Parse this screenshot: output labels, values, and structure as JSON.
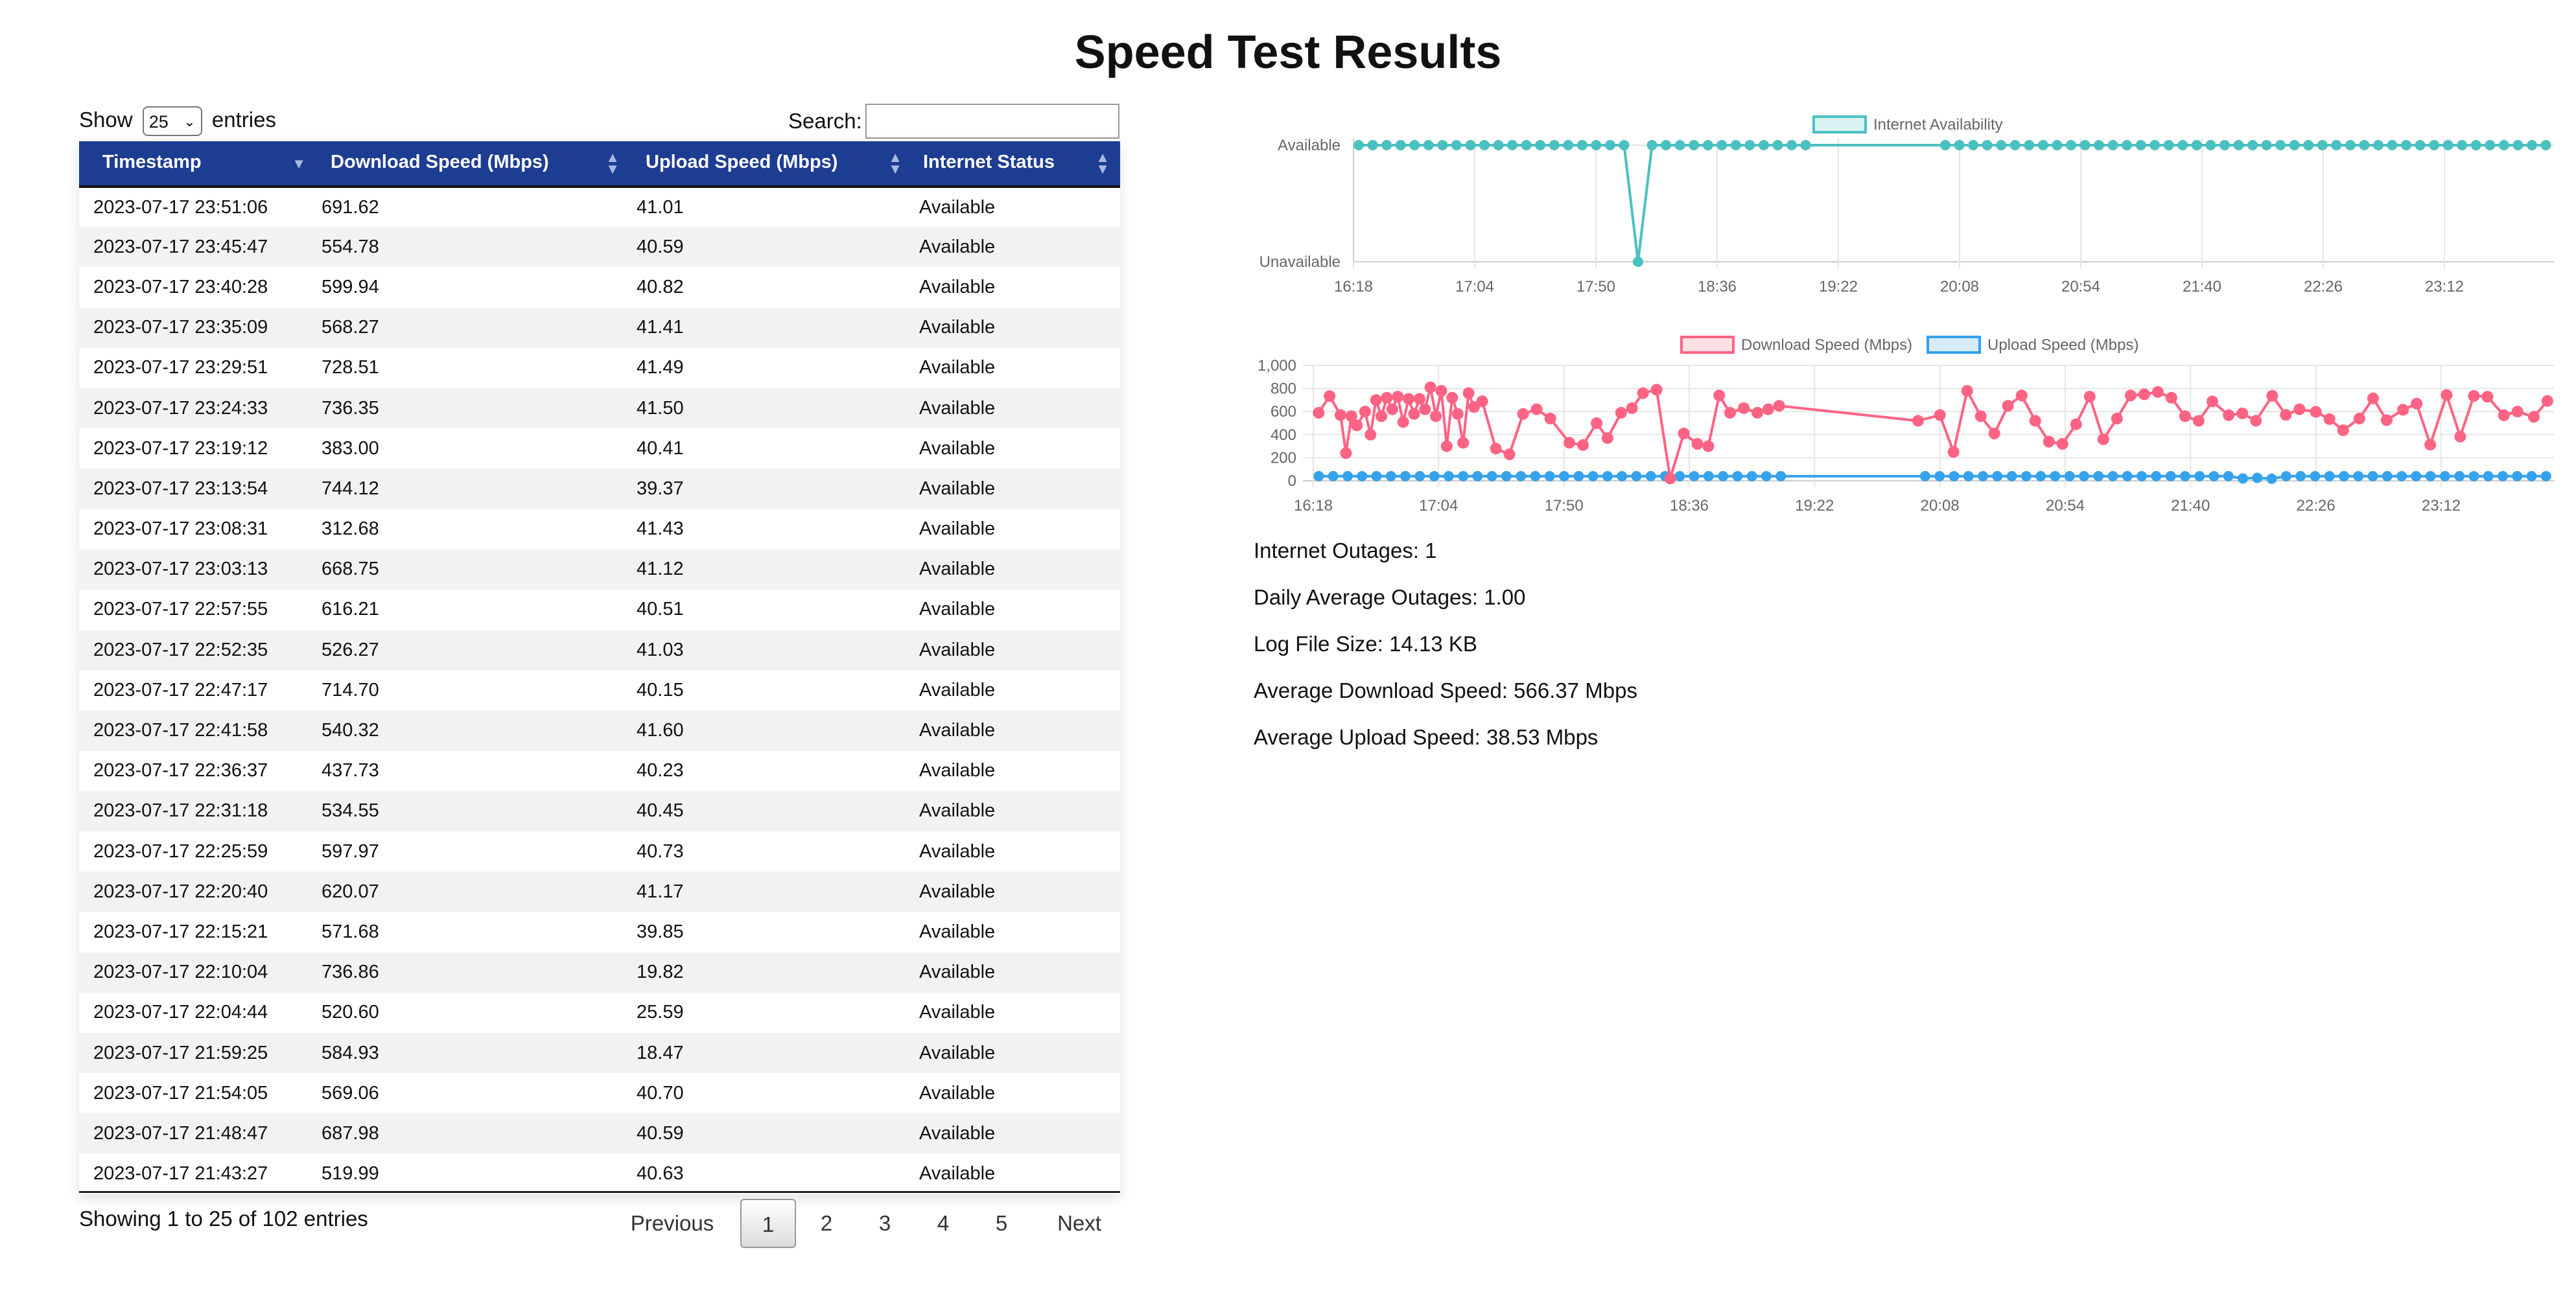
{
  "page": {
    "title": "Speed Test Results"
  },
  "table_controls": {
    "show_label": "Show",
    "entries_value": "25",
    "entries_label": "entries",
    "search_label": "Search:",
    "search_value": ""
  },
  "table": {
    "columns": [
      "Timestamp",
      "Download Speed (Mbps)",
      "Upload Speed (Mbps)",
      "Internet Status"
    ],
    "rows": [
      [
        "2023-07-17 23:51:06",
        "691.62",
        "41.01",
        "Available"
      ],
      [
        "2023-07-17 23:45:47",
        "554.78",
        "40.59",
        "Available"
      ],
      [
        "2023-07-17 23:40:28",
        "599.94",
        "40.82",
        "Available"
      ],
      [
        "2023-07-17 23:35:09",
        "568.27",
        "41.41",
        "Available"
      ],
      [
        "2023-07-17 23:29:51",
        "728.51",
        "41.49",
        "Available"
      ],
      [
        "2023-07-17 23:24:33",
        "736.35",
        "41.50",
        "Available"
      ],
      [
        "2023-07-17 23:19:12",
        "383.00",
        "40.41",
        "Available"
      ],
      [
        "2023-07-17 23:13:54",
        "744.12",
        "39.37",
        "Available"
      ],
      [
        "2023-07-17 23:08:31",
        "312.68",
        "41.43",
        "Available"
      ],
      [
        "2023-07-17 23:03:13",
        "668.75",
        "41.12",
        "Available"
      ],
      [
        "2023-07-17 22:57:55",
        "616.21",
        "40.51",
        "Available"
      ],
      [
        "2023-07-17 22:52:35",
        "526.27",
        "41.03",
        "Available"
      ],
      [
        "2023-07-17 22:47:17",
        "714.70",
        "40.15",
        "Available"
      ],
      [
        "2023-07-17 22:41:58",
        "540.32",
        "41.60",
        "Available"
      ],
      [
        "2023-07-17 22:36:37",
        "437.73",
        "40.23",
        "Available"
      ],
      [
        "2023-07-17 22:31:18",
        "534.55",
        "40.45",
        "Available"
      ],
      [
        "2023-07-17 22:25:59",
        "597.97",
        "40.73",
        "Available"
      ],
      [
        "2023-07-17 22:20:40",
        "620.07",
        "41.17",
        "Available"
      ],
      [
        "2023-07-17 22:15:21",
        "571.68",
        "39.85",
        "Available"
      ],
      [
        "2023-07-17 22:10:04",
        "736.86",
        "19.82",
        "Available"
      ],
      [
        "2023-07-17 22:04:44",
        "520.60",
        "25.59",
        "Available"
      ],
      [
        "2023-07-17 21:59:25",
        "584.93",
        "18.47",
        "Available"
      ],
      [
        "2023-07-17 21:54:05",
        "569.06",
        "40.70",
        "Available"
      ],
      [
        "2023-07-17 21:48:47",
        "687.98",
        "40.59",
        "Available"
      ],
      [
        "2023-07-17 21:43:27",
        "519.99",
        "40.63",
        "Available"
      ]
    ]
  },
  "table_footer": {
    "info": "Showing 1 to 25 of 102 entries",
    "previous": "Previous",
    "pages": [
      "1",
      "2",
      "3",
      "4",
      "5"
    ],
    "active_page": "1",
    "next": "Next"
  },
  "stats": {
    "outages": "Internet Outages: 1",
    "daily_avg": "Daily Average Outages: 1.00",
    "log_size": "Log File Size: 14.13 KB",
    "avg_download": "Average Download Speed: 566.37 Mbps",
    "avg_upload": "Average Upload Speed: 38.53 Mbps"
  },
  "colors": {
    "header_bg": "#1d3d92",
    "availability": "#4bc0c0",
    "download": "#ff6384",
    "upload": "#36a2eb"
  },
  "chart_data": [
    {
      "type": "line",
      "legend": [
        "Internet Availability"
      ],
      "legend_position": "top",
      "x_ticks": [
        "16:18",
        "17:04",
        "17:50",
        "18:36",
        "19:22",
        "20:08",
        "20:54",
        "21:40",
        "22:26",
        "23:12"
      ],
      "y_ticks": [
        "Available",
        "Unavailable"
      ],
      "grid": true,
      "series": [
        {
          "name": "Internet Availability",
          "outage_times": [
            "18:08"
          ],
          "value_when_up": "Available"
        }
      ]
    },
    {
      "type": "line",
      "legend": [
        "Download Speed (Mbps)",
        "Upload Speed (Mbps)"
      ],
      "legend_position": "top",
      "x_ticks": [
        "16:18",
        "17:04",
        "17:50",
        "18:36",
        "19:22",
        "20:08",
        "20:54",
        "21:40",
        "22:26",
        "23:12"
      ],
      "y_ticks": [
        "0",
        "200",
        "400",
        "600",
        "800",
        "1,000"
      ],
      "ylim": [
        0,
        1000
      ],
      "grid": true,
      "series": [
        {
          "name": "Download Speed (Mbps)",
          "points": [
            [
              "16:20",
              590
            ],
            [
              "16:24",
              735
            ],
            [
              "16:28",
              570
            ],
            [
              "16:30",
              240
            ],
            [
              "16:32",
              560
            ],
            [
              "16:34",
              480
            ],
            [
              "16:37",
              600
            ],
            [
              "16:39",
              400
            ],
            [
              "16:41",
              700
            ],
            [
              "16:43",
              560
            ],
            [
              "16:45",
              720
            ],
            [
              "16:47",
              620
            ],
            [
              "16:49",
              730
            ],
            [
              "16:51",
              510
            ],
            [
              "16:53",
              710
            ],
            [
              "16:55",
              580
            ],
            [
              "16:57",
              710
            ],
            [
              "16:59",
              620
            ],
            [
              "17:01",
              810
            ],
            [
              "17:03",
              560
            ],
            [
              "17:05",
              780
            ],
            [
              "17:07",
              300
            ],
            [
              "17:09",
              720
            ],
            [
              "17:11",
              580
            ],
            [
              "17:13",
              330
            ],
            [
              "17:15",
              760
            ],
            [
              "17:17",
              640
            ],
            [
              "17:20",
              690
            ],
            [
              "17:25",
              280
            ],
            [
              "17:30",
              230
            ],
            [
              "17:35",
              580
            ],
            [
              "17:40",
              620
            ],
            [
              "17:45",
              540
            ],
            [
              "17:52",
              330
            ],
            [
              "17:57",
              310
            ],
            [
              "18:02",
              500
            ],
            [
              "18:06",
              370
            ],
            [
              "18:11",
              590
            ],
            [
              "18:15",
              630
            ],
            [
              "18:19",
              760
            ],
            [
              "18:24",
              790
            ],
            [
              "18:29",
              20
            ],
            [
              "18:34",
              410
            ],
            [
              "18:39",
              320
            ],
            [
              "18:43",
              300
            ],
            [
              "18:47",
              740
            ],
            [
              "18:51",
              590
            ],
            [
              "18:56",
              630
            ],
            [
              "19:01",
              590
            ],
            [
              "19:05",
              620
            ],
            [
              "19:09",
              650
            ],
            [
              "20:00",
              520
            ],
            [
              "20:08",
              570
            ],
            [
              "20:13",
              250
            ],
            [
              "20:18",
              780
            ],
            [
              "20:23",
              560
            ],
            [
              "20:28",
              410
            ],
            [
              "20:33",
              650
            ],
            [
              "20:38",
              740
            ],
            [
              "20:43",
              520
            ],
            [
              "20:48",
              340
            ],
            [
              "20:53",
              320
            ],
            [
              "20:58",
              490
            ],
            [
              "21:03",
              730
            ],
            [
              "21:08",
              360
            ],
            [
              "21:13",
              540
            ],
            [
              "21:18",
              740
            ],
            [
              "21:23",
              750
            ],
            [
              "21:28",
              770
            ],
            [
              "21:33",
              720
            ],
            [
              "21:38",
              560
            ],
            [
              "21:43",
              520
            ],
            [
              "21:48",
              688
            ],
            [
              "21:54",
              569
            ],
            [
              "21:59",
              585
            ],
            [
              "22:04",
              521
            ],
            [
              "22:10",
              737
            ],
            [
              "22:15",
              572
            ],
            [
              "22:20",
              620
            ],
            [
              "22:26",
              598
            ],
            [
              "22:31",
              535
            ],
            [
              "22:36",
              438
            ],
            [
              "22:42",
              540
            ],
            [
              "22:47",
              715
            ],
            [
              "22:52",
              526
            ],
            [
              "22:58",
              616
            ],
            [
              "23:03",
              669
            ],
            [
              "23:08",
              313
            ],
            [
              "23:14",
              744
            ],
            [
              "23:19",
              383
            ],
            [
              "23:24",
              736
            ],
            [
              "23:29",
              729
            ],
            [
              "23:35",
              568
            ],
            [
              "23:40",
              600
            ],
            [
              "23:46",
              555
            ],
            [
              "23:51",
              692
            ]
          ]
        },
        {
          "name": "Upload Speed (Mbps)",
          "approx_value": 40,
          "dip_values": [
            18,
            20,
            26
          ]
        }
      ]
    }
  ]
}
